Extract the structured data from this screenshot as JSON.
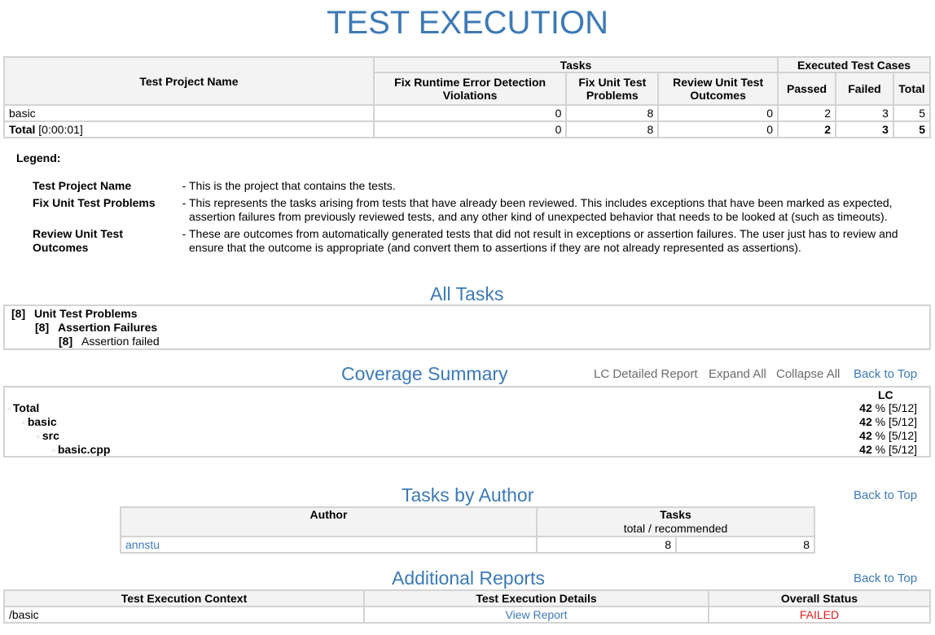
{
  "title": "TEST EXECUTION",
  "summary": {
    "header_project": "Test Project Name",
    "header_tasks": "Tasks",
    "header_executed": "Executed Test Cases",
    "col_runtime": "Fix Runtime Error Detection Violations",
    "col_fix": "Fix Unit Test Problems",
    "col_review": "Review Unit Test Outcomes",
    "col_passed": "Passed",
    "col_failed": "Failed",
    "col_total": "Total",
    "rows": [
      {
        "project": "basic",
        "runtime": "0",
        "fix": "8",
        "review": "0",
        "passed": "2",
        "failed": "3",
        "total": "5"
      }
    ],
    "total_row": {
      "label": "Total",
      "time": "[0:00:01]",
      "runtime": "0",
      "fix": "8",
      "review": "0",
      "passed": "2",
      "failed": "3",
      "total": "5"
    }
  },
  "legend": {
    "heading": "Legend:",
    "items": [
      {
        "term": "Test Project Name",
        "desc": "This is the project that contains the tests."
      },
      {
        "term": "Fix Unit Test Problems",
        "desc": "This represents the tasks arising from tests that have already been reviewed. This includes exceptions that have been marked as expected, assertion failures from previously reviewed tests, and any other kind of unexpected behavior that needs to be looked at (such as timeouts)."
      },
      {
        "term": "Review Unit Test Outcomes",
        "desc": "These are outcomes from automatically generated tests that did not result in exceptions or assertion failures. The user just has to review and ensure that the outcome is appropriate (and convert them to assertions if they are not already represented as assertions)."
      }
    ]
  },
  "all_tasks": {
    "title": "All Tasks",
    "items": [
      {
        "count": "[8]",
        "label": "Unit Test Problems"
      },
      {
        "count": "[8]",
        "label": "Assertion Failures"
      },
      {
        "count": "[8]",
        "label": "Assertion failed"
      }
    ]
  },
  "coverage": {
    "title": "Coverage Summary",
    "lc_report": "LC Detailed Report",
    "expand_all": "Expand All",
    "collapse_all": "Collapse All",
    "back_to_top": "Back to Top",
    "column": "LC",
    "rows": [
      {
        "name": "Total",
        "pct": "42",
        "ratio": "% [5/12]"
      },
      {
        "name": "basic",
        "pct": "42",
        "ratio": "% [5/12]"
      },
      {
        "name": "src",
        "pct": "42",
        "ratio": "% [5/12]"
      },
      {
        "name": "basic.cpp",
        "pct": "42",
        "ratio": "% [5/12]"
      }
    ]
  },
  "authors": {
    "title": "Tasks by Author",
    "back_to_top": "Back to Top",
    "col_author": "Author",
    "col_tasks": "Tasks",
    "col_tasks_sub": "total / recommended",
    "rows": [
      {
        "author": "annstu",
        "total": "8",
        "recommended": "8"
      }
    ]
  },
  "reports": {
    "title": "Additional Reports",
    "back_to_top": "Back to Top",
    "col_context": "Test Execution Context",
    "col_details": "Test Execution Details",
    "col_status": "Overall Status",
    "rows": [
      {
        "context": "/basic",
        "details": "View Report",
        "status": "FAILED"
      }
    ]
  },
  "colors": {
    "accent": "#3d7ab5",
    "failed": "#e02020",
    "border": "#d3d3d3",
    "link_gray": "#6b6b6b"
  }
}
